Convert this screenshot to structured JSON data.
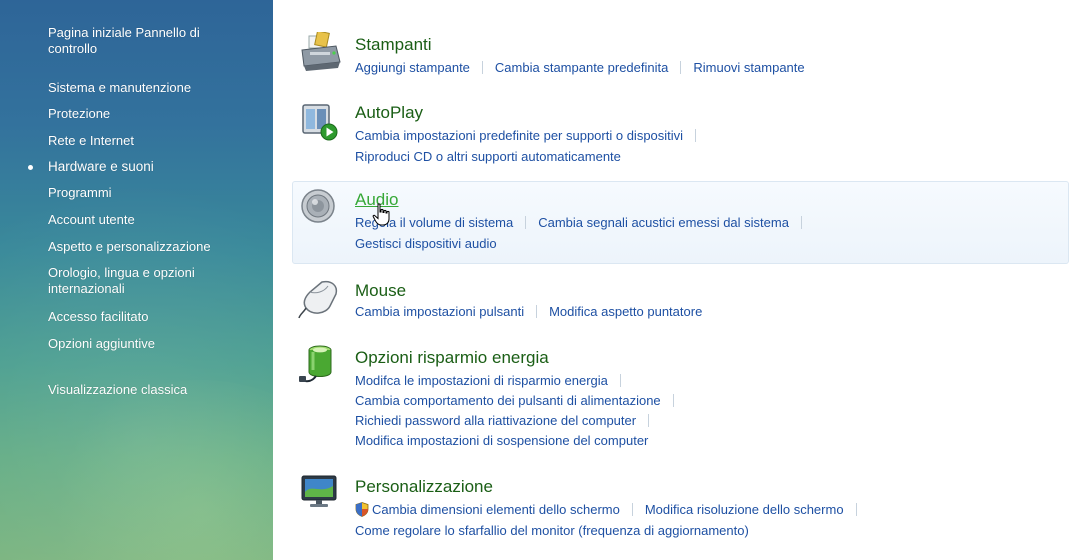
{
  "sidebar": {
    "items": [
      {
        "label": "Pagina iniziale Pannello di controllo"
      },
      {
        "label": "Sistema e manutenzione"
      },
      {
        "label": "Protezione"
      },
      {
        "label": "Rete e Internet"
      },
      {
        "label": "Hardware e suoni",
        "selected": true
      },
      {
        "label": "Programmi"
      },
      {
        "label": "Account utente"
      },
      {
        "label": "Aspetto e personalizzazione"
      },
      {
        "label": "Orologio, lingua e opzioni internazionali"
      },
      {
        "label": "Accesso facilitato"
      },
      {
        "label": "Opzioni aggiuntive"
      },
      {
        "label": "Visualizzazione classica"
      }
    ]
  },
  "categories": {
    "printers": {
      "title": "Stampanti",
      "icon": "printer-icon",
      "tasks": [
        "Aggiungi stampante",
        "Cambia stampante predefinita",
        "Rimuovi stampante"
      ]
    },
    "autoplay": {
      "title": "AutoPlay",
      "icon": "autoplay-icon",
      "tasks": [
        "Cambia impostazioni predefinite per supporti o dispositivi",
        "Riproduci CD o altri supporti automaticamente"
      ]
    },
    "audio": {
      "title": "Audio",
      "icon": "speaker-icon",
      "tasks": [
        "Regola il volume di sistema",
        "Cambia segnali acustici emessi dal sistema",
        "Gestisci dispositivi audio"
      ]
    },
    "mouse": {
      "title": "Mouse",
      "icon": "mouse-icon",
      "tasks": [
        "Cambia impostazioni pulsanti",
        "Modifica aspetto puntatore"
      ]
    },
    "power": {
      "title": "Opzioni risparmio energia",
      "icon": "battery-icon",
      "tasks": [
        "Modifca le impostazioni di risparmio energia",
        "Cambia comportamento dei pulsanti di alimentazione",
        "Richiedi password alla riattivazione del computer",
        "Modifica impostazioni di sospensione del computer"
      ]
    },
    "personalization": {
      "title": "Personalizzazione",
      "icon": "display-icon",
      "tasks": [
        "Cambia dimensioni elementi dello schermo",
        "Modifica risoluzione dello schermo",
        "Come regolare lo sfarfallio del monitor (frequenza di aggiornamento)"
      ]
    }
  },
  "colors": {
    "title_green": "#1a5e15",
    "title_hover": "#36a837",
    "link_blue": "#1e50a3"
  }
}
